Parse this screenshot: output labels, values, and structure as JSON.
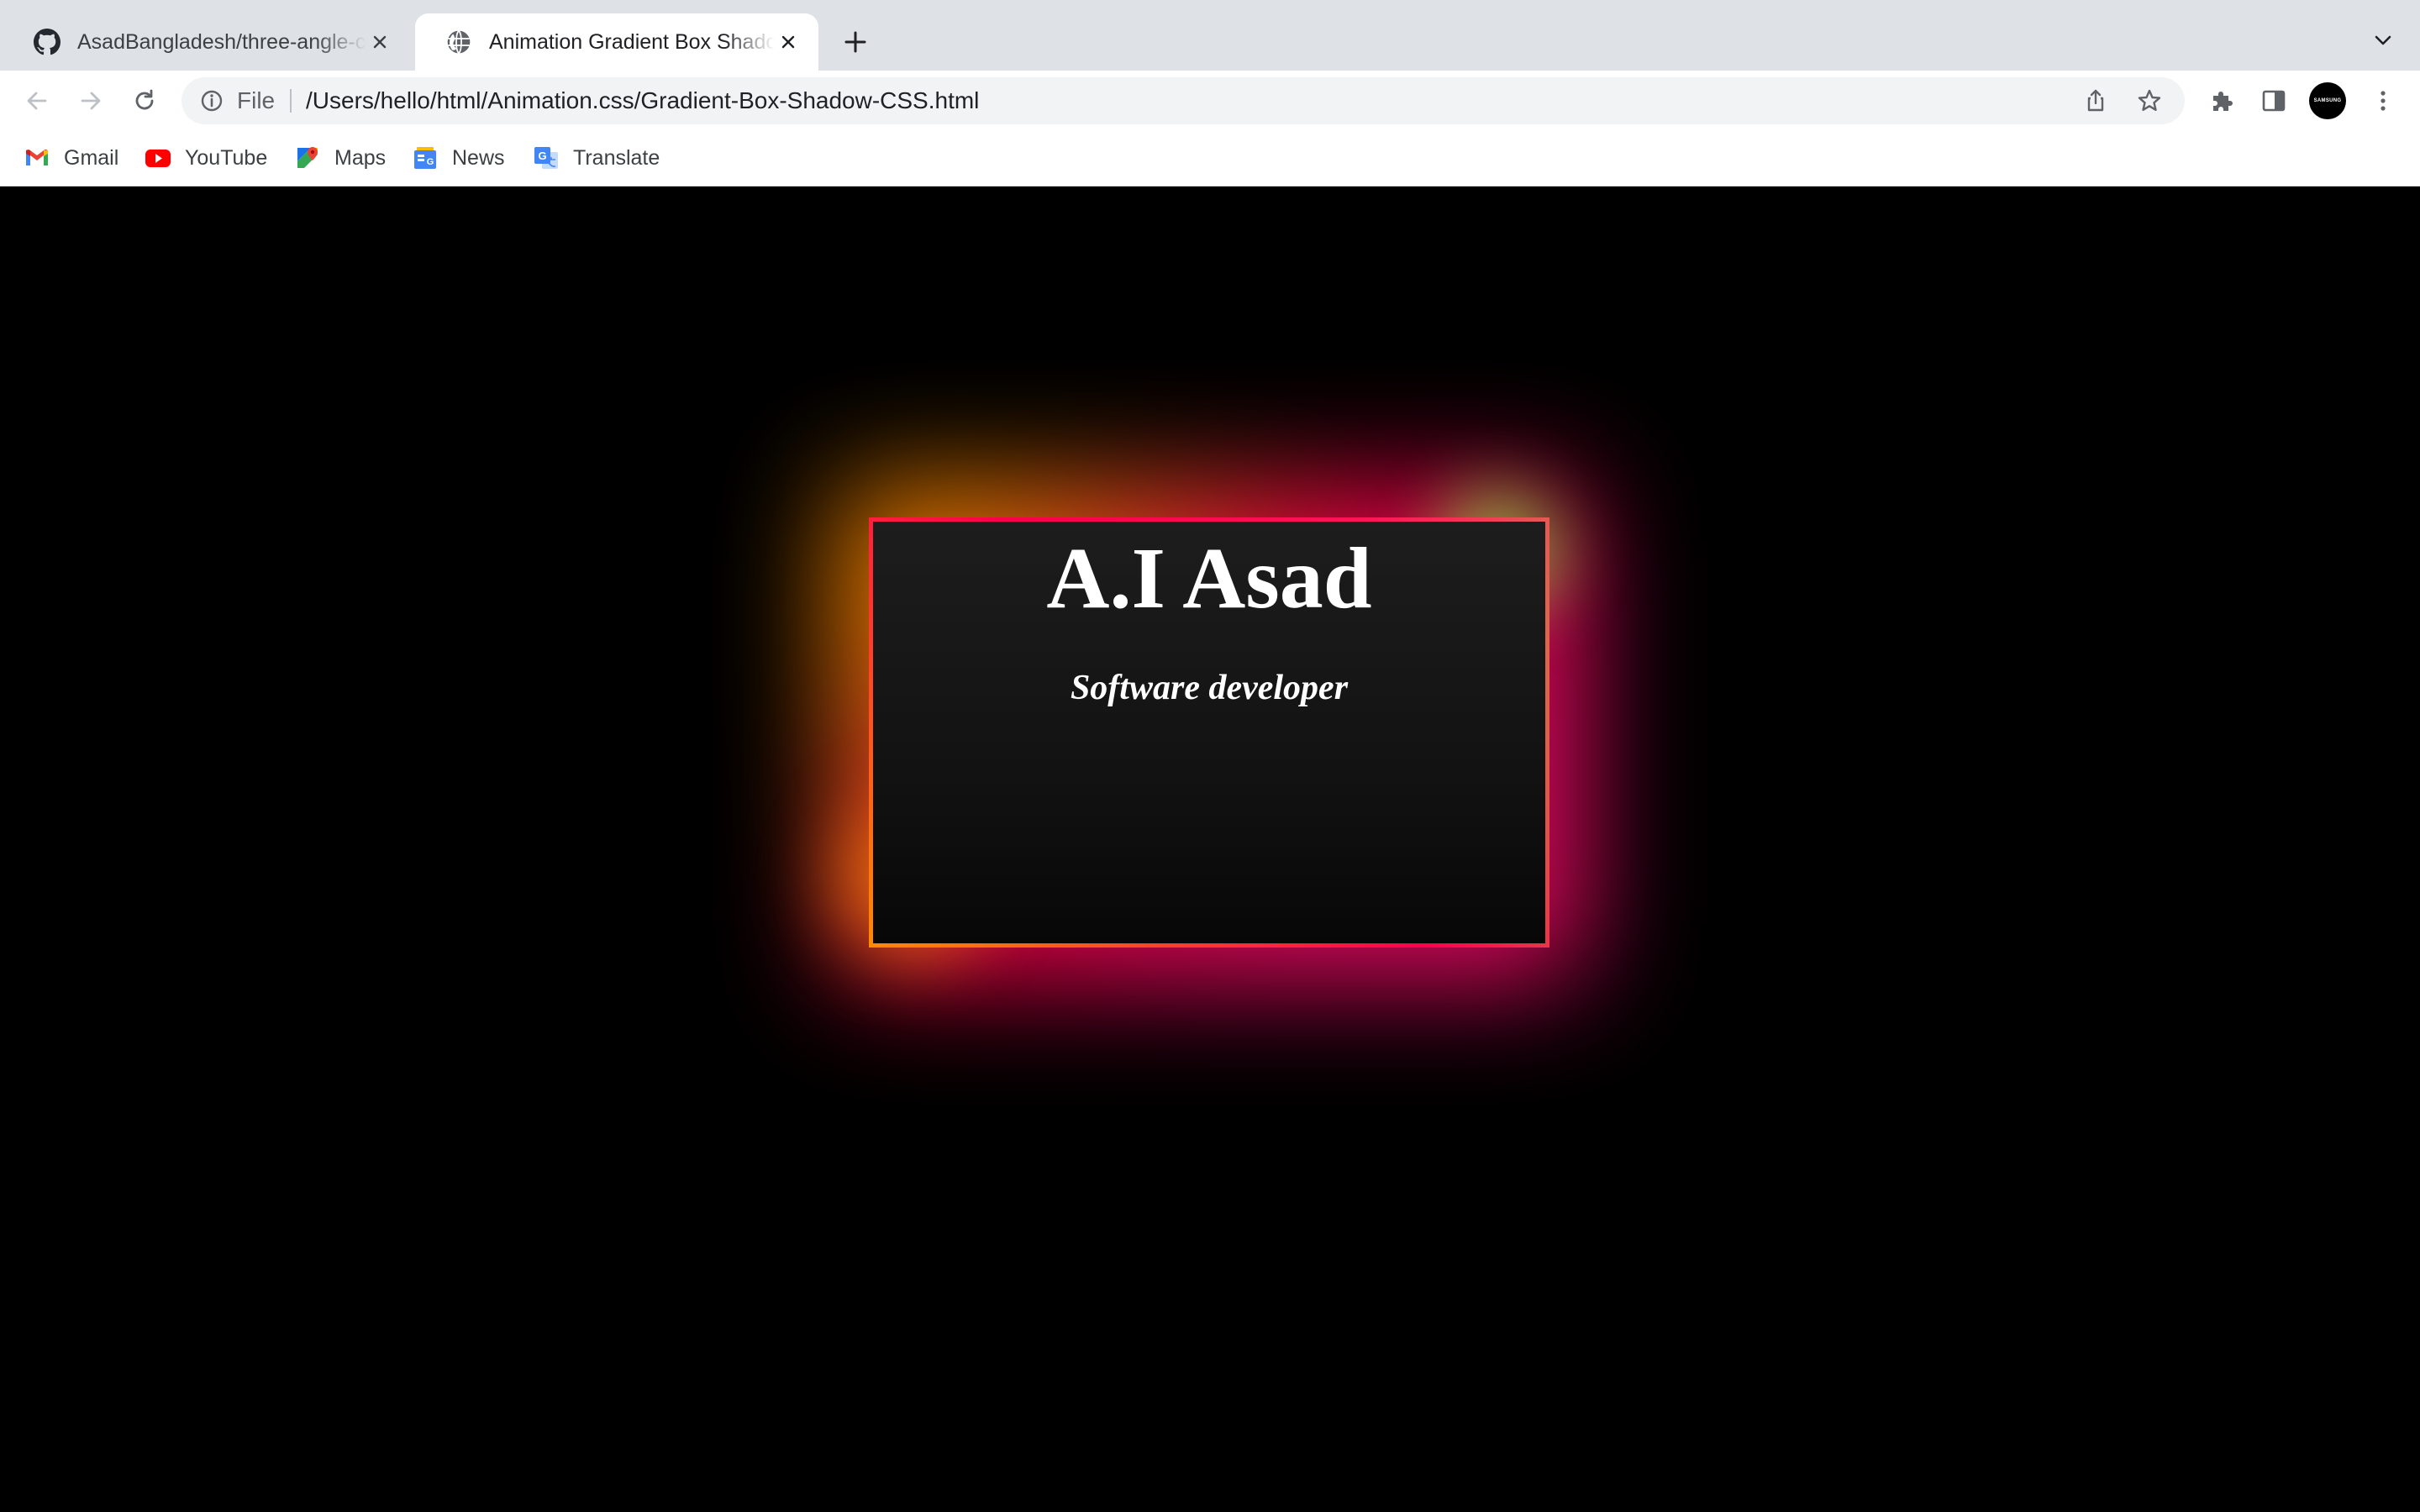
{
  "tabs": [
    {
      "title": "AsadBangladesh/three-angle-css",
      "active": false,
      "favicon": "github-icon"
    },
    {
      "title": "Animation Gradient Box Shadow CSS",
      "active": true,
      "favicon": "globe-icon"
    }
  ],
  "toolbar": {
    "scheme_label": "File",
    "url": "/Users/hello/html/Animation.css/Gradient-Box-Shadow-CSS.html",
    "avatar_text": "SAMSUNG"
  },
  "bookmarks": [
    {
      "label": "Gmail",
      "icon": "gmail-icon"
    },
    {
      "label": "YouTube",
      "icon": "youtube-icon"
    },
    {
      "label": "Maps",
      "icon": "maps-icon"
    },
    {
      "label": "News",
      "icon": "news-icon"
    },
    {
      "label": "Translate",
      "icon": "translate-icon"
    }
  ],
  "card": {
    "name": "A.I Asad",
    "role": "Software developer"
  },
  "colors": {
    "page_background": "#000000",
    "glow_pink": "#ff0a6c",
    "glow_orange": "#ff8a00",
    "glow_green": "#a8e63c"
  }
}
